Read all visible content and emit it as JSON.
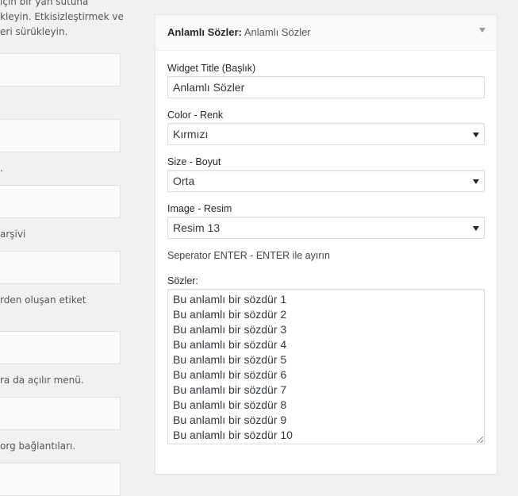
{
  "left_panel": {
    "top_desc_lines": [
      "için bir yan sütuna",
      "kleyin. Etkisizleştirmek ve",
      "eri sürükleyin."
    ],
    "descs": [
      ".",
      "arşivi",
      "rden oluşan etiket",
      "ra da açılır menü.",
      "org bağlantıları."
    ]
  },
  "widget": {
    "title_main": "Anlamlı Sözler",
    "title_separator": ":",
    "title_instance": "Anlamlı Sözler",
    "fields": {
      "title": {
        "label": "Widget Title (Başlık)",
        "value": "Anlamlı Sözler"
      },
      "color": {
        "label": "Color - Renk",
        "value": "Kırmızı"
      },
      "size": {
        "label": "Size - Boyut",
        "value": "Orta"
      },
      "image": {
        "label": "Image - Resim",
        "value": "Resim 13"
      }
    },
    "separator_note": "Seperator ENTER - ENTER ile ayırın",
    "sozler": {
      "label": "Sözler:",
      "lines": [
        "Bu anlamlı bir sözdür 1",
        "Bu anlamlı bir sözdür 2",
        "Bu anlamlı bir sözdür 3",
        "Bu anlamlı bir sözdür 4",
        "Bu anlamlı bir sözdür 5",
        "Bu anlamlı bir sözdür 6",
        "Bu anlamlı bir sözdür 7",
        "Bu anlamlı bir sözdür 8",
        "Bu anlamlı bir sözdür 9",
        "Bu anlamlı bir sözdür 10"
      ]
    }
  }
}
